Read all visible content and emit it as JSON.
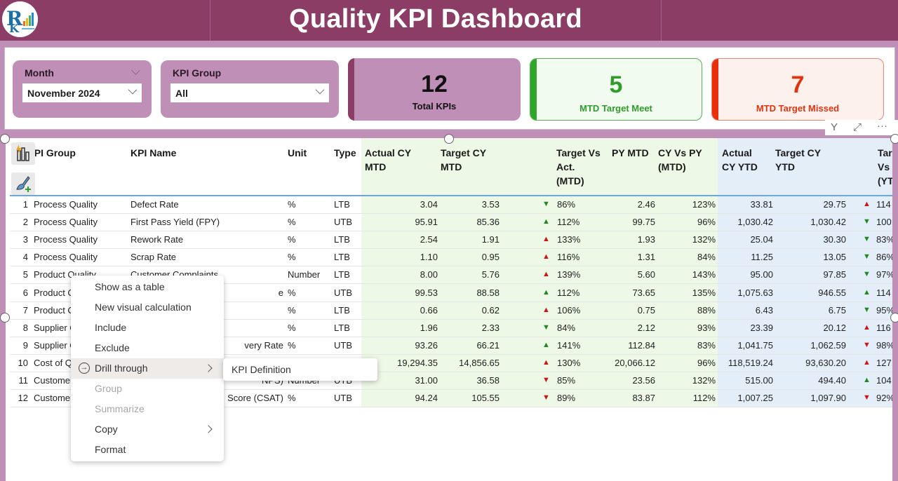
{
  "header": {
    "title": "Quality KPI Dashboard",
    "logo": "company-logo"
  },
  "colors": {
    "header_bg": "#8B3D66",
    "panel_accent": "#C08FB8",
    "green": "#2f9c2b",
    "red": "#e0340f",
    "mtd_band": "#EEF8E6",
    "ytd_band": "#E4EEF8"
  },
  "filters": {
    "month": {
      "label": "Month",
      "value": "November 2024"
    },
    "kpi_group": {
      "label": "KPI Group",
      "value": "All"
    }
  },
  "cards": {
    "total": {
      "value": "12",
      "caption": "Total KPIs"
    },
    "meet": {
      "value": "5",
      "caption": "MTD Target Meet"
    },
    "missed": {
      "value": "7",
      "caption": "MTD Target Missed"
    }
  },
  "visual_tools": {
    "filter_icon": "Y",
    "focus_icon": "⤢",
    "more_icon": "···"
  },
  "table": {
    "headers": {
      "kpi_group": "KPI Group",
      "kpi_group_visible": " PI Group",
      "kpi_name": "KPI Name",
      "unit": "Unit",
      "type": "Type",
      "actual_cy_mtd": "Actual CY MTD",
      "target_cy_mtd": "Target CY MTD",
      "target_vs_act_mtd": "Target Vs Act. (MTD)",
      "py_mtd": "PY MTD",
      "cy_vs_py_mtd": "CY Vs PY (MTD)",
      "actual_cy_ytd": "Actual CY YTD",
      "target_cy_ytd": "Target CY YTD",
      "target_vs_act_ytd": "Target Vs (YTD)"
    },
    "header_lines": {
      "actual_cy_mtd": [
        "Actual CY",
        "MTD"
      ],
      "target_cy_mtd": [
        "Target CY",
        "MTD"
      ],
      "target_vs_act_mtd": [
        "Target Vs",
        "Act.",
        "(MTD)"
      ],
      "py_mtd": [
        "PY MTD"
      ],
      "cy_vs_py_mtd": [
        "CY Vs PY",
        "(MTD)"
      ],
      "actual_cy_ytd": [
        "Actual",
        "CY YTD"
      ],
      "target_cy_ytd": [
        "Target CY",
        "YTD"
      ],
      "target_vs_act_ytd": [
        "Tar",
        "Vs",
        "(YT"
      ]
    },
    "rows": [
      {
        "n": "1",
        "group": "Process Quality",
        "name": "Defect Rate",
        "unit": "%",
        "type": "LTB",
        "act_mtd": "3.04",
        "tgt_mtd": "3.53",
        "mtd_dir": "down",
        "mtd_color": "green",
        "mtd_pct": "86%",
        "py_mtd": "2.46",
        "cy_vs_py": "123%",
        "act_ytd": "33.81",
        "tgt_ytd": "29.75",
        "ytd_dir": "up",
        "ytd_color": "red",
        "ytd_pct": "114"
      },
      {
        "n": "2",
        "group": "Process Quality",
        "name": "First Pass Yield (FPY)",
        "unit": "%",
        "type": "UTB",
        "act_mtd": "95.91",
        "tgt_mtd": "85.36",
        "mtd_dir": "up",
        "mtd_color": "green",
        "mtd_pct": "112%",
        "py_mtd": "99.75",
        "cy_vs_py": "96%",
        "act_ytd": "1,030.42",
        "tgt_ytd": "1,030.42",
        "ytd_dir": "down",
        "ytd_color": "green",
        "ytd_pct": "100"
      },
      {
        "n": "3",
        "group": "Process Quality",
        "name": "Rework Rate",
        "unit": "%",
        "type": "LTB",
        "act_mtd": "2.54",
        "tgt_mtd": "1.91",
        "mtd_dir": "up",
        "mtd_color": "red",
        "mtd_pct": "133%",
        "py_mtd": "1.93",
        "cy_vs_py": "132%",
        "act_ytd": "25.04",
        "tgt_ytd": "30.30",
        "ytd_dir": "down",
        "ytd_color": "green",
        "ytd_pct": "83%"
      },
      {
        "n": "4",
        "group": "Process Quality",
        "name": "Scrap Rate",
        "unit": "%",
        "type": "LTB",
        "act_mtd": "1.10",
        "tgt_mtd": "0.95",
        "mtd_dir": "up",
        "mtd_color": "red",
        "mtd_pct": "116%",
        "py_mtd": "1.31",
        "cy_vs_py": "84%",
        "act_ytd": "11.25",
        "tgt_ytd": "13.05",
        "ytd_dir": "down",
        "ytd_color": "green",
        "ytd_pct": "86%"
      },
      {
        "n": "5",
        "group": "Product Quality",
        "name": "Customer Complaints",
        "unit": "Number",
        "type": "LTB",
        "act_mtd": "8.00",
        "tgt_mtd": "5.76",
        "mtd_dir": "up",
        "mtd_color": "red",
        "mtd_pct": "139%",
        "py_mtd": "5.60",
        "cy_vs_py": "143%",
        "act_ytd": "95.00",
        "tgt_ytd": "97.85",
        "ytd_dir": "down",
        "ytd_color": "green",
        "ytd_pct": "97%"
      },
      {
        "n": "6",
        "group": "Product C",
        "name": "",
        "name_tail": "e",
        "unit": "%",
        "type": "UTB",
        "act_mtd": "99.53",
        "tgt_mtd": "88.58",
        "mtd_dir": "up",
        "mtd_color": "green",
        "mtd_pct": "112%",
        "py_mtd": "73.65",
        "cy_vs_py": "135%",
        "act_ytd": "1,075.63",
        "tgt_ytd": "946.55",
        "ytd_dir": "up",
        "ytd_color": "green",
        "ytd_pct": "114"
      },
      {
        "n": "7",
        "group": "Product C",
        "name": "",
        "name_tail": "",
        "unit": "%",
        "type": "LTB",
        "act_mtd": "0.66",
        "tgt_mtd": "0.62",
        "mtd_dir": "up",
        "mtd_color": "red",
        "mtd_pct": "106%",
        "py_mtd": "0.75",
        "cy_vs_py": "88%",
        "act_ytd": "6.43",
        "tgt_ytd": "6.75",
        "ytd_dir": "down",
        "ytd_color": "green",
        "ytd_pct": "95%"
      },
      {
        "n": "8",
        "group": "Supplier C",
        "name": "",
        "name_tail": "",
        "unit": "%",
        "type": "LTB",
        "act_mtd": "1.96",
        "tgt_mtd": "2.33",
        "mtd_dir": "down",
        "mtd_color": "green",
        "mtd_pct": "84%",
        "py_mtd": "2.12",
        "cy_vs_py": "93%",
        "act_ytd": "23.39",
        "tgt_ytd": "20.12",
        "ytd_dir": "up",
        "ytd_color": "red",
        "ytd_pct": "116"
      },
      {
        "n": "9",
        "group": "Supplier C",
        "name": "",
        "name_tail": "very Rate",
        "unit": "%",
        "type": "UTB",
        "act_mtd": "93.26",
        "tgt_mtd": "66.21",
        "mtd_dir": "up",
        "mtd_color": "green",
        "mtd_pct": "141%",
        "py_mtd": "112.84",
        "cy_vs_py": "83%",
        "act_ytd": "1,041.75",
        "tgt_ytd": "1,062.59",
        "ytd_dir": "down",
        "ytd_color": "red",
        "ytd_pct": "98%"
      },
      {
        "n": "10",
        "group": "Cost of Qu",
        "name": "",
        "name_tail": "",
        "unit": "",
        "type": "",
        "act_mtd": "19,294.35",
        "tgt_mtd": "14,856.65",
        "mtd_dir": "up",
        "mtd_color": "red",
        "mtd_pct": "130%",
        "py_mtd": "20,066.12",
        "cy_vs_py": "96%",
        "act_ytd": "118,519.24",
        "tgt_ytd": "93,630.20",
        "ytd_dir": "up",
        "ytd_color": "red",
        "ytd_pct": "127"
      },
      {
        "n": "11",
        "group": "Customer",
        "name": "",
        "name_tail": "NPS)",
        "unit": "Number",
        "type": "UTB",
        "act_mtd": "31.00",
        "tgt_mtd": "36.58",
        "mtd_dir": "down",
        "mtd_color": "red",
        "mtd_pct": "85%",
        "py_mtd": "23.56",
        "cy_vs_py": "132%",
        "act_ytd": "515.00",
        "tgt_ytd": "494.40",
        "ytd_dir": "up",
        "ytd_color": "green",
        "ytd_pct": "104"
      },
      {
        "n": "12",
        "group": "Customer",
        "name": "",
        "name_tail": "Score (CSAT)",
        "unit": "%",
        "type": "UTB",
        "act_mtd": "94.24",
        "tgt_mtd": "105.55",
        "mtd_dir": "down",
        "mtd_color": "red",
        "mtd_pct": "89%",
        "py_mtd": "83.87",
        "cy_vs_py": "112%",
        "act_ytd": "1,007.25",
        "tgt_ytd": "1,097.90",
        "ytd_dir": "down",
        "ytd_color": "red",
        "ytd_pct": "92%"
      }
    ]
  },
  "context_menu": {
    "items": [
      {
        "label": "Show as a table",
        "disabled": false,
        "submenu": false
      },
      {
        "label": "New visual calculation",
        "disabled": false,
        "submenu": false
      },
      {
        "label": "Include",
        "disabled": false,
        "submenu": false
      },
      {
        "label": "Exclude",
        "disabled": false,
        "submenu": false
      },
      {
        "label": "Drill through",
        "disabled": false,
        "submenu": true,
        "hover": true,
        "icon": "drill-through-icon"
      },
      {
        "label": "Group",
        "disabled": true,
        "submenu": false
      },
      {
        "label": "Summarize",
        "disabled": true,
        "submenu": false
      },
      {
        "label": "Copy",
        "disabled": false,
        "submenu": true
      },
      {
        "label": "Format",
        "disabled": false,
        "submenu": false
      }
    ],
    "submenu": {
      "label": "KPI Definition"
    }
  }
}
